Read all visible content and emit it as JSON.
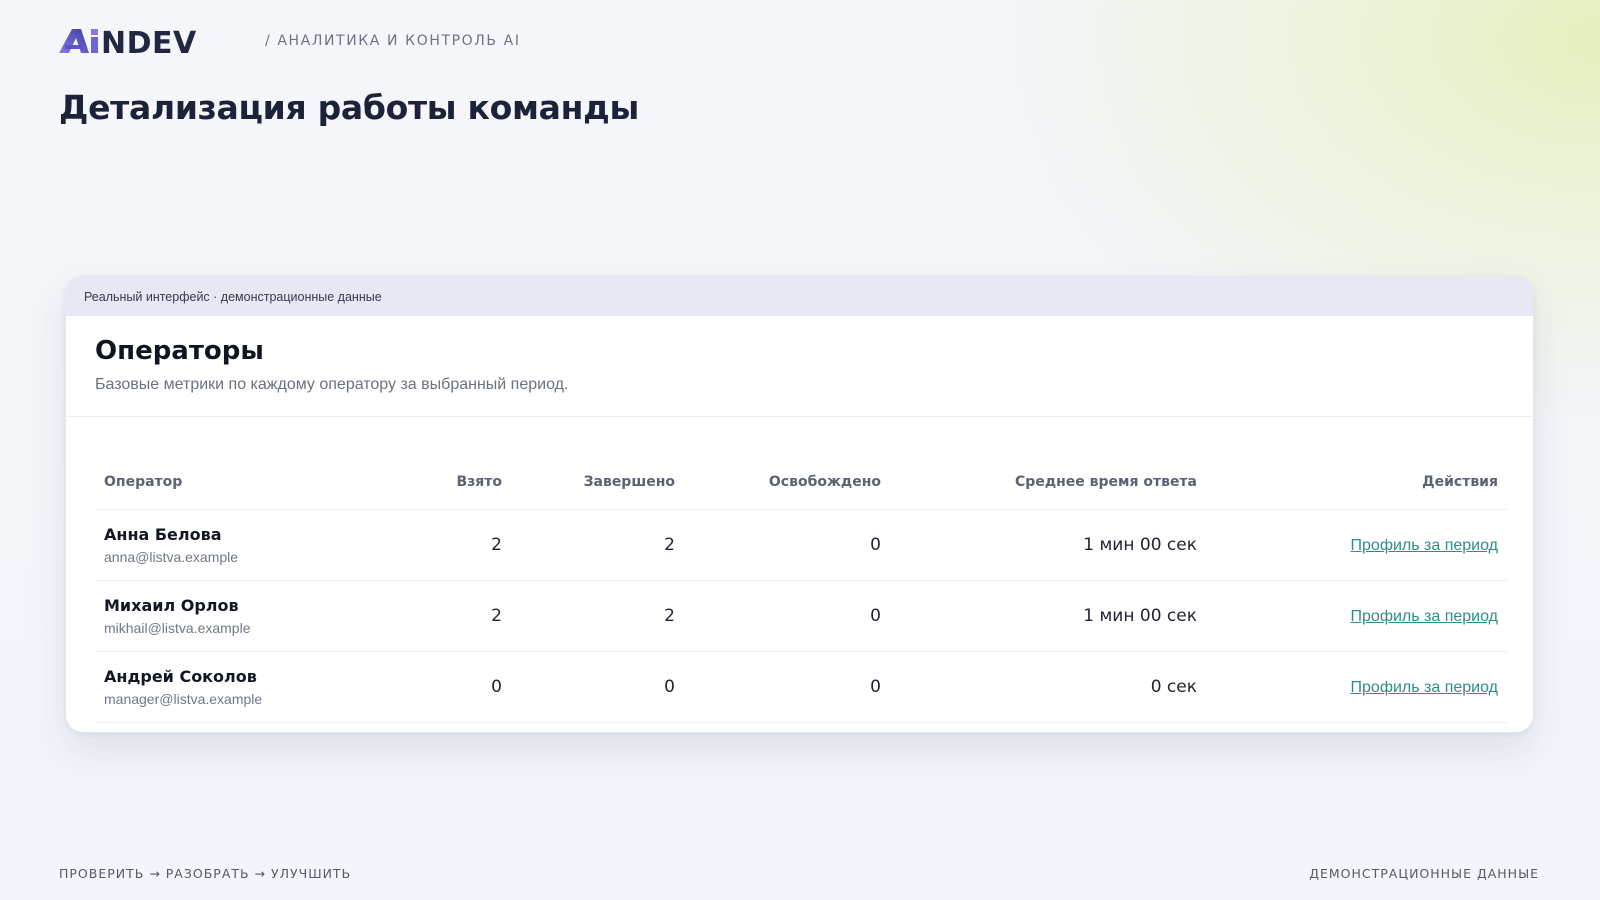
{
  "header": {
    "logo_text": "AiNDEV",
    "crumb": "/ АНАЛИТИКА И КОНТРОЛЬ AI",
    "title": "Детализация работы команды"
  },
  "card": {
    "strip": "Реальный интерфейс · демонстрационные данные",
    "title": "Операторы",
    "subtitle": "Базовые метрики по каждому оператору за выбранный период."
  },
  "table": {
    "columns": [
      "Оператор",
      "Взято",
      "Завершено",
      "Освобождено",
      "Среднее время ответа",
      "Действия"
    ],
    "rows": [
      {
        "name": "Анна Белова",
        "email": "anna@listva.example",
        "taken": "2",
        "done": "2",
        "released": "0",
        "avg": "1 мин 00 сек",
        "action": "Профиль за период"
      },
      {
        "name": "Михаил Орлов",
        "email": "mikhail@listva.example",
        "taken": "2",
        "done": "2",
        "released": "0",
        "avg": "1 мин 00 сек",
        "action": "Профиль за период"
      },
      {
        "name": "Андрей Соколов",
        "email": "manager@listva.example",
        "taken": "0",
        "done": "0",
        "released": "0",
        "avg": "0 сек",
        "action": "Профиль за период"
      }
    ]
  },
  "footer": {
    "left": "ПРОВЕРИТЬ → РАЗОБРАТЬ → УЛУЧШИТЬ",
    "right": "ДЕМОНСТРАЦИОННЫЕ ДАННЫЕ"
  },
  "colors": {
    "logo_gradient_start": "#8a78ea",
    "logo_gradient_end": "#3d3f9a",
    "logo_text": "#232842",
    "link": "#2e8f86",
    "title": "#1c2238"
  }
}
